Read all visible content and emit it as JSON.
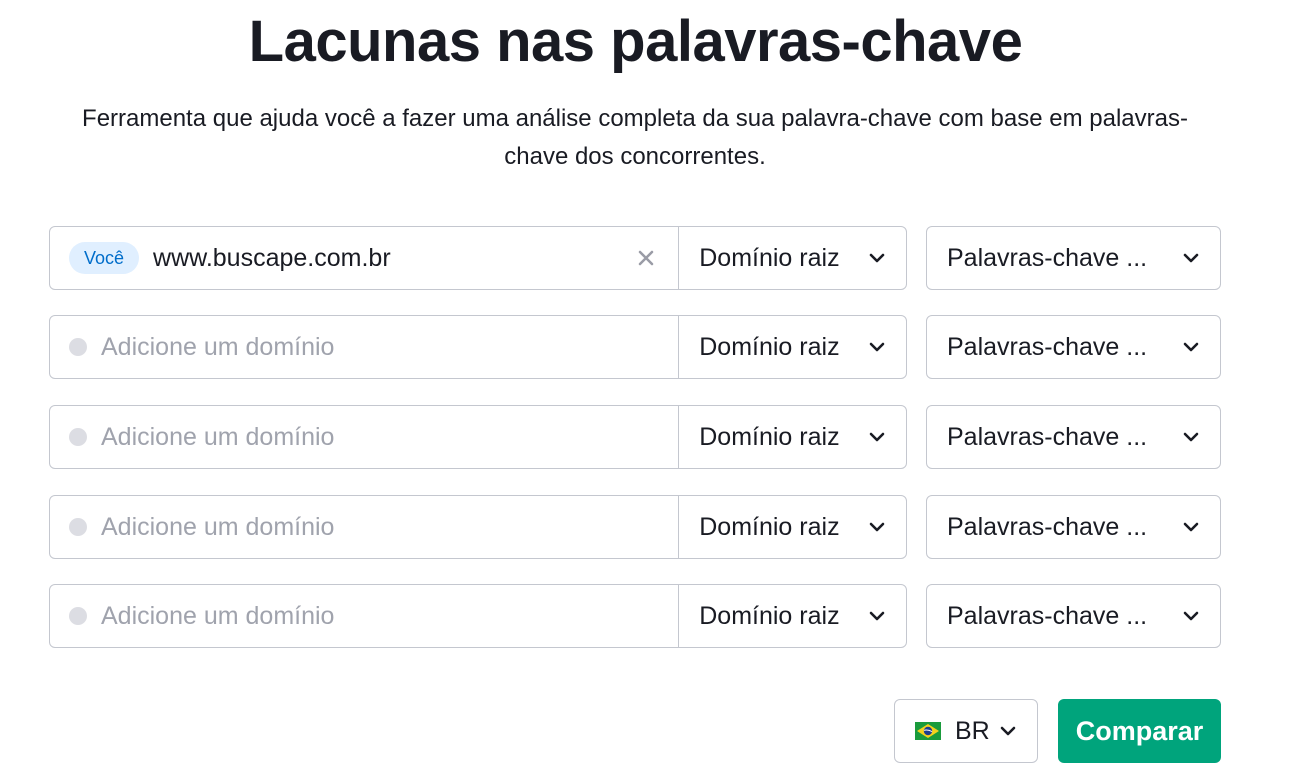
{
  "header": {
    "title": "Lacunas nas palavras-chave",
    "subtitle": "Ferramenta que ajuda você a fazer uma análise completa da sua palavra-chave com base em palavras-chave dos concorrentes."
  },
  "domains": [
    {
      "badge": "Você",
      "value": "www.buscape.com.br",
      "scope": "Domínio raiz",
      "keyword_type": "Palavras-chave ..."
    },
    {
      "placeholder": "Adicione um domínio",
      "scope": "Domínio raiz",
      "keyword_type": "Palavras-chave ..."
    },
    {
      "placeholder": "Adicione um domínio",
      "scope": "Domínio raiz",
      "keyword_type": "Palavras-chave ..."
    },
    {
      "placeholder": "Adicione um domínio",
      "scope": "Domínio raiz",
      "keyword_type": "Palavras-chave ..."
    },
    {
      "placeholder": "Adicione um domínio",
      "scope": "Domínio raiz",
      "keyword_type": "Palavras-chave ..."
    }
  ],
  "footer": {
    "country": "BR",
    "country_flag_icon": "brazil-flag-icon",
    "compare_label": "Comparar"
  },
  "colors": {
    "accent": "#00a47c",
    "badge_bg": "#e0efff",
    "badge_text": "#006dca",
    "border": "#c4c7cf",
    "placeholder": "#a0a3ad"
  }
}
